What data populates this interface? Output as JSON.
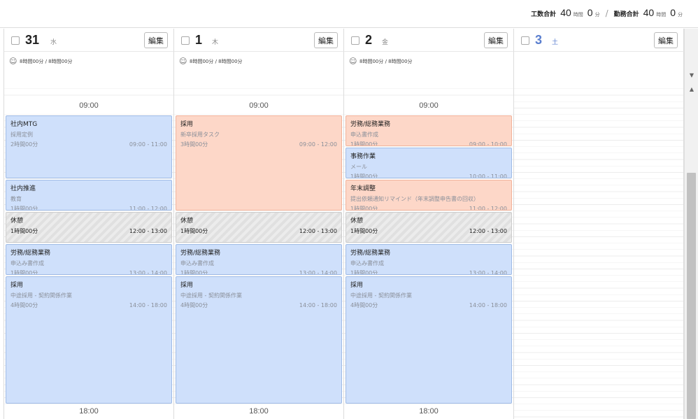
{
  "totals": {
    "work_label": "工数合計",
    "work_hours": "40",
    "hours_unit": "時間",
    "work_minutes": "0",
    "minutes_unit": "分",
    "separator": "/",
    "duty_label": "勤務合計",
    "duty_hours": "40",
    "duty_minutes": "0"
  },
  "edit_label": "編集",
  "days": [
    {
      "num": "31",
      "dow": "水",
      "summary": "8時間00分 / 8時間00分",
      "time_top": "09:00",
      "time_bottom": "18:00",
      "events": [
        {
          "type": "blue",
          "title": "社内MTG",
          "sub": "採用定例",
          "duration": "2時間00分",
          "range": "09:00 - 11:00"
        },
        {
          "type": "blue",
          "title": "社内推進",
          "sub": "教育",
          "duration": "1時間00分",
          "range": "11:00 - 12:00"
        },
        {
          "type": "break",
          "title": "休憩",
          "sub": "",
          "duration": "1時間00分",
          "range": "12:00 - 13:00"
        },
        {
          "type": "blue",
          "title": "労務/総務業務",
          "sub": "申込み書作成",
          "duration": "1時間00分",
          "range": "13:00 - 14:00"
        },
        {
          "type": "blue",
          "title": "採用",
          "sub": "中途採用 - 契約関係作業",
          "duration": "4時間00分",
          "range": "14:00 - 18:00"
        }
      ]
    },
    {
      "num": "1",
      "dow": "木",
      "summary": "8時間00分 / 8時間00分",
      "time_top": "09:00",
      "time_bottom": "18:00",
      "events": [
        {
          "type": "orange",
          "title": "採用",
          "sub": "新卒採用タスク",
          "duration": "3時間00分",
          "range": "09:00 - 12:00"
        },
        {
          "type": "break",
          "title": "休憩",
          "sub": "",
          "duration": "1時間00分",
          "range": "12:00 - 13:00"
        },
        {
          "type": "blue",
          "title": "労務/総務業務",
          "sub": "申込み書作成",
          "duration": "1時間00分",
          "range": "13:00 - 14:00"
        },
        {
          "type": "blue",
          "title": "採用",
          "sub": "中途採用 - 契約関係作業",
          "duration": "4時間00分",
          "range": "14:00 - 18:00"
        }
      ]
    },
    {
      "num": "2",
      "dow": "金",
      "summary": "8時間00分 / 8時間00分",
      "time_top": "09:00",
      "time_bottom": "18:00",
      "events": [
        {
          "type": "orange",
          "title": "労務/総務業務",
          "sub": "申込書作成",
          "duration": "1時間00分",
          "range": "09:00 - 10:00"
        },
        {
          "type": "blue",
          "title": "事務作業",
          "sub": "メール",
          "duration": "1時間00分",
          "range": "10:00 - 11:00"
        },
        {
          "type": "orange",
          "title": "年末調整",
          "sub": "提出依頼通知リマインド（年末調整申告書の回収）",
          "duration": "1時間00分",
          "range": "11:00 - 12:00"
        },
        {
          "type": "break",
          "title": "休憩",
          "sub": "",
          "duration": "1時間00分",
          "range": "12:00 - 13:00"
        },
        {
          "type": "blue",
          "title": "労務/総務業務",
          "sub": "申込み書作成",
          "duration": "1時間00分",
          "range": "13:00 - 14:00"
        },
        {
          "type": "blue",
          "title": "採用",
          "sub": "中途採用 - 契約関係作業",
          "duration": "4時間00分",
          "range": "14:00 - 18:00"
        }
      ]
    },
    {
      "num": "3",
      "dow": "土",
      "summary": "",
      "time_top": "",
      "time_bottom": "",
      "events": []
    }
  ]
}
